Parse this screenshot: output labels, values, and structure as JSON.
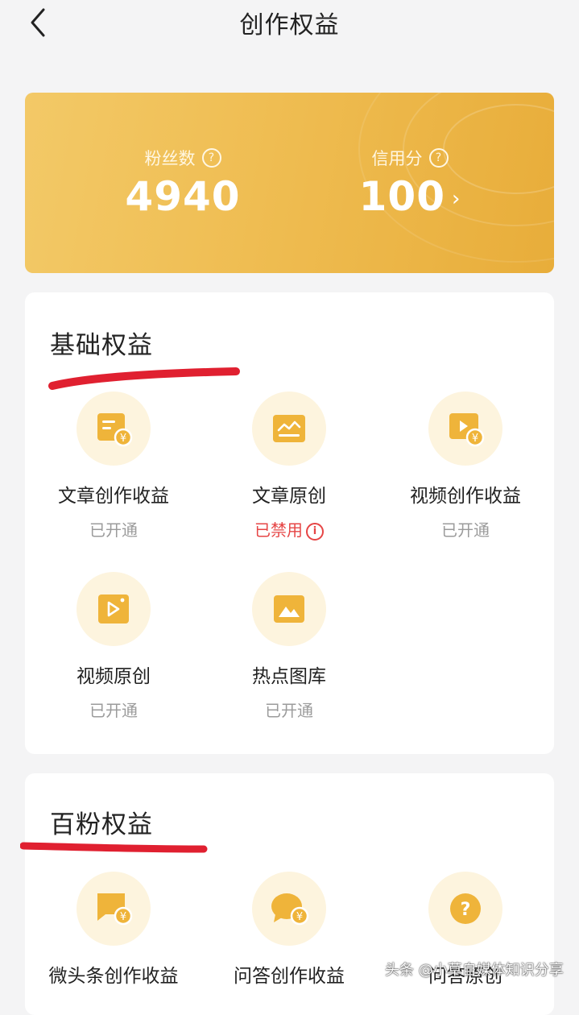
{
  "header": {
    "title": "创作权益"
  },
  "stats": {
    "fans": {
      "label": "粉丝数",
      "value": "4940"
    },
    "credit": {
      "label": "信用分",
      "value": "100"
    }
  },
  "basic": {
    "title": "基础权益",
    "items": [
      {
        "label": "文章创作收益",
        "status": "已开通",
        "icon": "article-income-icon"
      },
      {
        "label": "文章原创",
        "status": "已禁用",
        "icon": "article-original-icon"
      },
      {
        "label": "视频创作收益",
        "status": "已开通",
        "icon": "video-income-icon"
      },
      {
        "label": "视频原创",
        "status": "已开通",
        "icon": "video-original-icon"
      },
      {
        "label": "热点图库",
        "status": "已开通",
        "icon": "image-library-icon"
      }
    ]
  },
  "hundred": {
    "title": "百粉权益",
    "items": [
      {
        "label": "微头条创作收益",
        "icon": "micro-headline-income-icon"
      },
      {
        "label": "问答创作收益",
        "icon": "qa-income-icon"
      },
      {
        "label": "问答原创",
        "icon": "qa-original-icon"
      }
    ]
  },
  "watermark": "头条 @小草自媒体知识分享",
  "colors": {
    "accent": "#efbd52",
    "icon": "#efb43a",
    "danger": "#e64545",
    "marker": "#e02030"
  }
}
